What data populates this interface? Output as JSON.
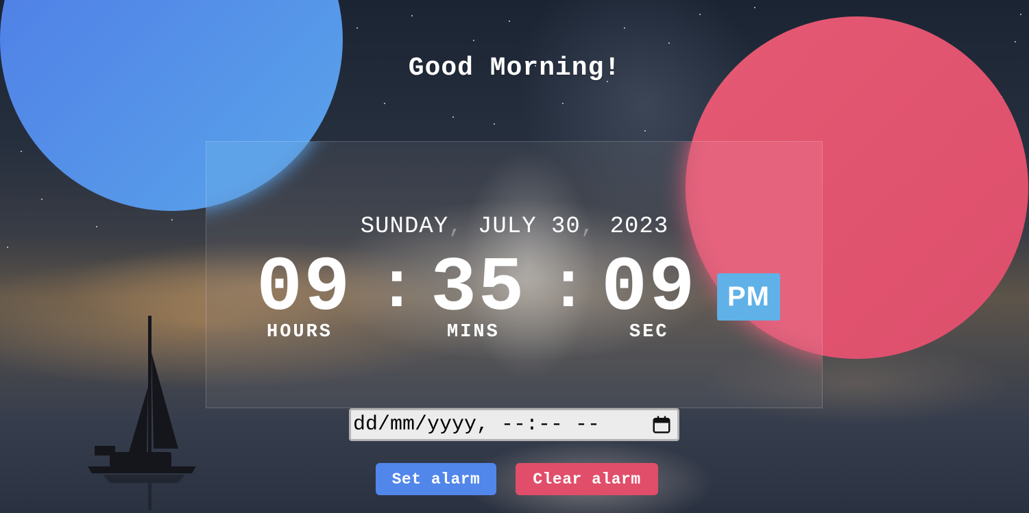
{
  "greeting": "Good Morning!",
  "date": {
    "weekday": "SUNDAY",
    "month_day": "JULY 30",
    "year": "2023",
    "separator": ","
  },
  "clock": {
    "hours": "09",
    "minutes": "35",
    "seconds": "09",
    "colon": ":",
    "period": "PM",
    "labels": {
      "hours": "HOURS",
      "minutes": "MINS",
      "seconds": "SEC"
    }
  },
  "alarm": {
    "input_placeholder": "dd/mm/yyyy, --:-- --",
    "set_label": "Set alarm",
    "clear_label": "Clear alarm"
  },
  "colors": {
    "blue_circle": "#5aa5ea",
    "red_circle": "#e55973",
    "period_badge": "#5fb1e8",
    "set_button": "#5186ea",
    "clear_button": "#e04e6a"
  },
  "icons": {
    "alarm_input": "calendar-icon"
  }
}
